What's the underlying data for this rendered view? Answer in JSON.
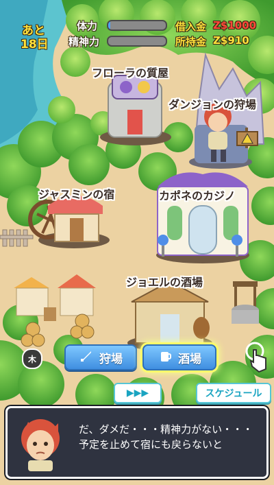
{
  "status": {
    "days_left_label": "あと",
    "days_left_value": "18日",
    "hp_label": "体力",
    "hp_level": 0.04,
    "mental_label": "精神力",
    "mental_level": 0.0,
    "debt_label": "借入金",
    "debt_value": "Z$1000",
    "money_label": "所持金",
    "money_value": "Z$910"
  },
  "locations": {
    "pawnshop": "フローラの質屋",
    "dungeon": "ダンジョンの狩場",
    "inn": "ジャスミンの宿",
    "casino": "カポネのカジノ",
    "tavern": "ジョエルの酒場"
  },
  "weekday_badge": "木",
  "actions": {
    "hunt_label": "狩場",
    "tavern_label": "酒場"
  },
  "controls": {
    "fast_forward_label": "▶▶▶",
    "schedule_label": "スケジュール"
  },
  "dialog": {
    "line1": "だ、ダメだ・・・精神力がない・・・",
    "line2": "予定を止めて宿にも戻らないと"
  },
  "colors": {
    "accent_blue": "#3f8ee0",
    "money_yellow": "#ffe23c",
    "debt_red": "#ff4a3a",
    "dialog_bg": "#2f3340"
  },
  "icons": {
    "hunt": "sword-icon",
    "tavern": "beer-mug-icon",
    "tap_hint": "pointing-hand-icon",
    "warning": "warning-sign-icon"
  }
}
